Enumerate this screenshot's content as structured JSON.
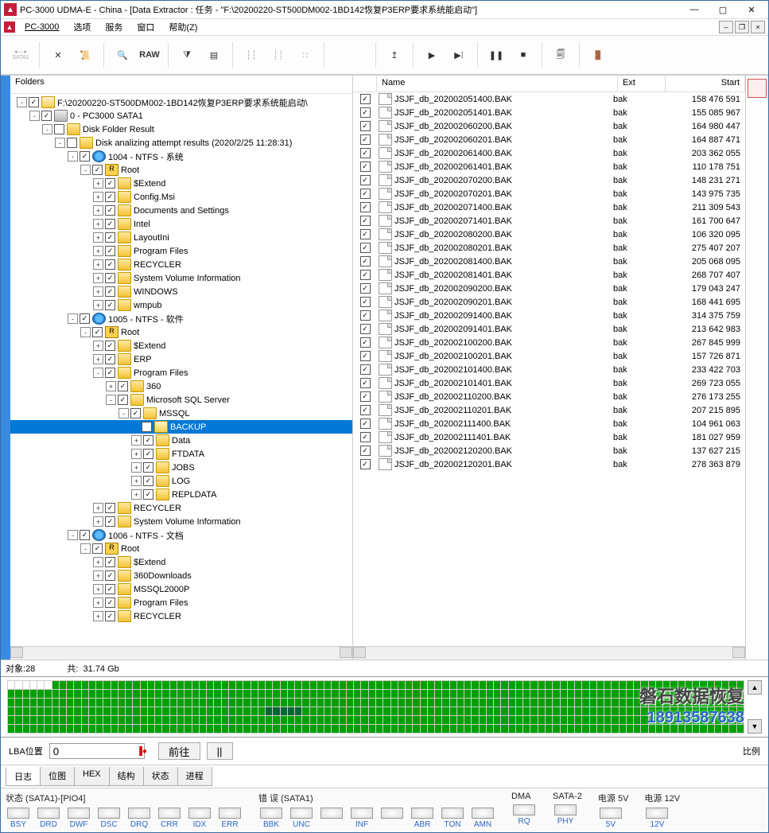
{
  "window": {
    "title": "PC-3000 UDMA-E - China - [Data Extractor : 任务 - \"F:\\20200220-ST500DM002-1BD142恢复P3ERP要求系统能启动\"]"
  },
  "menu": {
    "brand": "PC-3000",
    "items": [
      "选项",
      "服务",
      "窗口",
      "帮助(Z)"
    ]
  },
  "folders_header": "Folders",
  "tree": [
    {
      "d": 0,
      "t": "-",
      "c": true,
      "i": "folder-open",
      "l": "F:\\20200220-ST500DM002-1BD142恢复P3ERP要求系统能启动\\"
    },
    {
      "d": 1,
      "t": "-",
      "c": true,
      "i": "drive",
      "l": "0 - PC3000 SATA1"
    },
    {
      "d": 2,
      "t": "-",
      "c": false,
      "i": "folder",
      "l": "Disk Folder Result"
    },
    {
      "d": 3,
      "t": "-",
      "c": false,
      "i": "folder",
      "l": "Disk analizing attempt results (2020/2/25 11:28:31)"
    },
    {
      "d": 4,
      "t": "-",
      "c": true,
      "i": "globe",
      "l": "1004 - NTFS - 系统"
    },
    {
      "d": 5,
      "t": "-",
      "c": true,
      "i": "rootbox",
      "l": "Root",
      "root": true
    },
    {
      "d": 6,
      "t": "+",
      "c": true,
      "i": "folder",
      "l": "$Extend"
    },
    {
      "d": 6,
      "t": "+",
      "c": true,
      "i": "folder",
      "l": "Config.Msi"
    },
    {
      "d": 6,
      "t": "+",
      "c": true,
      "i": "folder",
      "l": "Documents and Settings"
    },
    {
      "d": 6,
      "t": "+",
      "c": true,
      "i": "folder",
      "l": "Intel"
    },
    {
      "d": 6,
      "t": "+",
      "c": true,
      "i": "folder",
      "l": "LayoutIni"
    },
    {
      "d": 6,
      "t": "+",
      "c": true,
      "i": "folder",
      "l": "Program Files"
    },
    {
      "d": 6,
      "t": "+",
      "c": true,
      "i": "folder",
      "l": "RECYCLER"
    },
    {
      "d": 6,
      "t": "+",
      "c": true,
      "i": "folder",
      "l": "System Volume Information"
    },
    {
      "d": 6,
      "t": "+",
      "c": true,
      "i": "folder",
      "l": "WINDOWS"
    },
    {
      "d": 6,
      "t": "+",
      "c": true,
      "i": "folder",
      "l": "wmpub"
    },
    {
      "d": 4,
      "t": "-",
      "c": true,
      "i": "globe",
      "l": "1005 - NTFS - 软件"
    },
    {
      "d": 5,
      "t": "-",
      "c": true,
      "i": "rootbox",
      "l": "Root",
      "root": true
    },
    {
      "d": 6,
      "t": "+",
      "c": true,
      "i": "folder",
      "l": "$Extend"
    },
    {
      "d": 6,
      "t": "+",
      "c": true,
      "i": "folder",
      "l": "ERP"
    },
    {
      "d": 6,
      "t": "-",
      "c": true,
      "i": "folder",
      "l": "Program Files"
    },
    {
      "d": 7,
      "t": "+",
      "c": true,
      "i": "folder",
      "l": "360"
    },
    {
      "d": 7,
      "t": "-",
      "c": true,
      "i": "folder",
      "l": "Microsoft SQL Server"
    },
    {
      "d": 8,
      "t": "-",
      "c": true,
      "i": "folder",
      "l": "MSSQL"
    },
    {
      "d": 9,
      "t": "",
      "c": true,
      "i": "folder-open",
      "l": "BACKUP",
      "sel": true
    },
    {
      "d": 9,
      "t": "+",
      "c": true,
      "i": "folder",
      "l": "Data"
    },
    {
      "d": 9,
      "t": "+",
      "c": true,
      "i": "folder",
      "l": "FTDATA"
    },
    {
      "d": 9,
      "t": "+",
      "c": true,
      "i": "folder",
      "l": "JOBS"
    },
    {
      "d": 9,
      "t": "+",
      "c": true,
      "i": "folder",
      "l": "LOG"
    },
    {
      "d": 9,
      "t": "+",
      "c": true,
      "i": "folder",
      "l": "REPLDATA"
    },
    {
      "d": 6,
      "t": "+",
      "c": true,
      "i": "folder",
      "l": "RECYCLER"
    },
    {
      "d": 6,
      "t": "+",
      "c": true,
      "i": "folder",
      "l": "System Volume Information"
    },
    {
      "d": 4,
      "t": "-",
      "c": true,
      "i": "globe",
      "l": "1006 - NTFS - 文档"
    },
    {
      "d": 5,
      "t": "-",
      "c": true,
      "i": "rootbox",
      "l": "Root",
      "root": true
    },
    {
      "d": 6,
      "t": "+",
      "c": true,
      "i": "folder",
      "l": "$Extend"
    },
    {
      "d": 6,
      "t": "+",
      "c": true,
      "i": "folder",
      "l": "360Downloads"
    },
    {
      "d": 6,
      "t": "+",
      "c": true,
      "i": "folder",
      "l": "MSSQL2000P"
    },
    {
      "d": 6,
      "t": "+",
      "c": true,
      "i": "folder",
      "l": "Program Files"
    },
    {
      "d": 6,
      "t": "+",
      "c": true,
      "i": "folder",
      "l": "RECYCLER"
    }
  ],
  "filecols": {
    "name": "Name",
    "ext": "Ext",
    "start": "Start"
  },
  "files": [
    {
      "n": "JSJF_db_202002051400.BAK",
      "e": "bak",
      "s": "158 476 591"
    },
    {
      "n": "JSJF_db_202002051401.BAK",
      "e": "bak",
      "s": "155 085 967"
    },
    {
      "n": "JSJF_db_202002060200.BAK",
      "e": "bak",
      "s": "164 980 447"
    },
    {
      "n": "JSJF_db_202002060201.BAK",
      "e": "bak",
      "s": "164 887 471"
    },
    {
      "n": "JSJF_db_202002061400.BAK",
      "e": "bak",
      "s": "203 362 055"
    },
    {
      "n": "JSJF_db_202002061401.BAK",
      "e": "bak",
      "s": "110 178 751"
    },
    {
      "n": "JSJF_db_202002070200.BAK",
      "e": "bak",
      "s": "148 231 271"
    },
    {
      "n": "JSJF_db_202002070201.BAK",
      "e": "bak",
      "s": "143 975 735"
    },
    {
      "n": "JSJF_db_202002071400.BAK",
      "e": "bak",
      "s": "211 309 543"
    },
    {
      "n": "JSJF_db_202002071401.BAK",
      "e": "bak",
      "s": "161 700 647"
    },
    {
      "n": "JSJF_db_202002080200.BAK",
      "e": "bak",
      "s": "106 320 095"
    },
    {
      "n": "JSJF_db_202002080201.BAK",
      "e": "bak",
      "s": "275 407 207"
    },
    {
      "n": "JSJF_db_202002081400.BAK",
      "e": "bak",
      "s": "205 068 095"
    },
    {
      "n": "JSJF_db_202002081401.BAK",
      "e": "bak",
      "s": "268 707 407"
    },
    {
      "n": "JSJF_db_202002090200.BAK",
      "e": "bak",
      "s": "179 043 247"
    },
    {
      "n": "JSJF_db_202002090201.BAK",
      "e": "bak",
      "s": "168 441 695"
    },
    {
      "n": "JSJF_db_202002091400.BAK",
      "e": "bak",
      "s": "314 375 759"
    },
    {
      "n": "JSJF_db_202002091401.BAK",
      "e": "bak",
      "s": "213 642 983"
    },
    {
      "n": "JSJF_db_202002100200.BAK",
      "e": "bak",
      "s": "267 845 999"
    },
    {
      "n": "JSJF_db_202002100201.BAK",
      "e": "bak",
      "s": "157 726 871"
    },
    {
      "n": "JSJF_db_202002101400.BAK",
      "e": "bak",
      "s": "233 422 703"
    },
    {
      "n": "JSJF_db_202002101401.BAK",
      "e": "bak",
      "s": "269 723 055"
    },
    {
      "n": "JSJF_db_202002110200.BAK",
      "e": "bak",
      "s": "276 173 255"
    },
    {
      "n": "JSJF_db_202002110201.BAK",
      "e": "bak",
      "s": "207 215 895"
    },
    {
      "n": "JSJF_db_202002111400.BAK",
      "e": "bak",
      "s": "104 961 063"
    },
    {
      "n": "JSJF_db_202002111401.BAK",
      "e": "bak",
      "s": "181 027 959"
    },
    {
      "n": "JSJF_db_202002120200.BAK",
      "e": "bak",
      "s": "137 627 215"
    },
    {
      "n": "JSJF_db_202002120201.BAK",
      "e": "bak",
      "s": "278 363 879"
    }
  ],
  "stats": {
    "objects_label": "对象:",
    "objects_value": "28",
    "total_label": "共:",
    "total_value": "31.74 Gb"
  },
  "lba": {
    "label": "LBA位置",
    "value": "0",
    "go": "前往",
    "pause": "||",
    "legend": "比例"
  },
  "watermarks": {
    "text1": "磐石数据恢复",
    "text2": "18913587638"
  },
  "tabs": [
    "日志",
    "位图",
    "HEX",
    "结构",
    "状态",
    "进程"
  ],
  "active_tab": 0,
  "status_groups": [
    {
      "label": "状态 (SATA1)-[PIO4]",
      "leds": [
        "BSY",
        "DRD",
        "DWF",
        "DSC",
        "DRQ",
        "CRR",
        "IDX",
        "ERR"
      ]
    },
    {
      "label": "错 误 (SATA1)",
      "leds": [
        "BBK",
        "UNC",
        "",
        "INF",
        "",
        "ABR",
        "TON",
        "AMN"
      ]
    },
    {
      "label": "DMA",
      "leds": [
        "RQ"
      ]
    },
    {
      "label": "SATA-2",
      "leds": [
        "PHY"
      ]
    },
    {
      "label": "电源 5V",
      "leds": [
        "5V"
      ]
    },
    {
      "label": "电源 12V",
      "leds": [
        "12V"
      ]
    }
  ],
  "toolbar": {
    "sata": "SATA1",
    "raw": "RAW"
  }
}
